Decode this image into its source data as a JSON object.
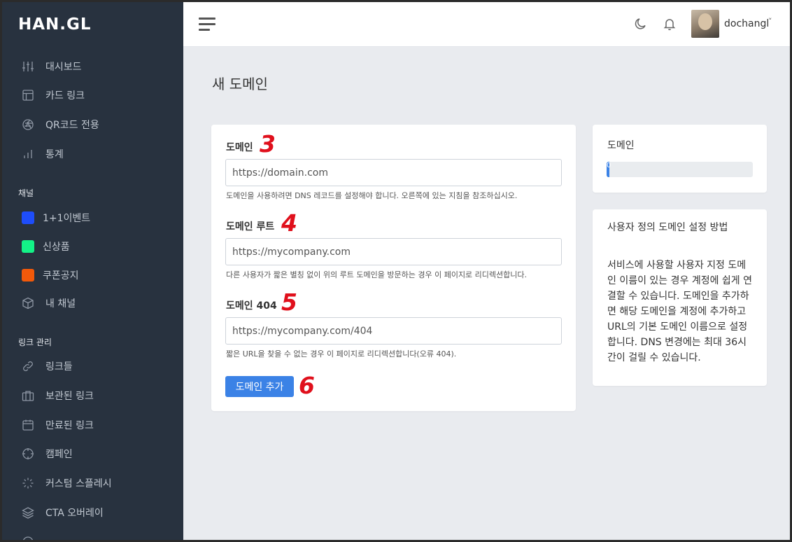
{
  "brand": {
    "logo": "HAN.GL"
  },
  "sidebar": {
    "main_items": [
      {
        "label": "대시보드",
        "icon": "sliders-icon"
      },
      {
        "label": "카드 링크",
        "icon": "layout-icon"
      },
      {
        "label": "QR코드 전용",
        "icon": "aperture-icon"
      },
      {
        "label": "통계",
        "icon": "bar-chart-icon"
      }
    ],
    "channels_title": "채널",
    "channels": [
      {
        "label": "1+1이벤트",
        "color": "#1e4dfa"
      },
      {
        "label": "신상품",
        "color": "#13f287"
      },
      {
        "label": "쿠폰공지",
        "color": "#f2590a"
      },
      {
        "label": "내 채널",
        "icon": "box-icon"
      }
    ],
    "links_title": "링크 관리",
    "link_items": [
      {
        "label": "링크들",
        "icon": "link-icon"
      },
      {
        "label": "보관된 링크",
        "icon": "briefcase-icon"
      },
      {
        "label": "만료된 링크",
        "icon": "calendar-icon"
      },
      {
        "label": "캠페인",
        "icon": "crosshair-icon"
      },
      {
        "label": "커스텀 스플레시",
        "icon": "loader-icon"
      },
      {
        "label": "CTA 오버레이",
        "icon": "layers-icon"
      }
    ]
  },
  "header": {
    "username": "dochangl",
    "caret": "˅"
  },
  "page": {
    "title": "새 도메인"
  },
  "form": {
    "domain": {
      "label": "도메인",
      "marker": "3",
      "placeholder": "https://domain.com",
      "help": "도메인을 사용하려면 DNS 레코드를 설정해야 합니다. 오른쪽에 있는 지침을 참조하십시오."
    },
    "root": {
      "label": "도메인 루트",
      "marker": "4",
      "placeholder": "https://mycompany.com",
      "help": "다른 사용자가 짧은 별칭 없이 위의 루트 도메인을 방문하는 경우 이 페이지로 리디렉션합니다."
    },
    "notfound": {
      "label": "도메인 404",
      "marker": "5",
      "placeholder": "https://mycompany.com/404",
      "help": "짧은 URL을 찾을 수 없는 경우 이 페이지로 리디렉션합니다(오류 404)."
    },
    "submit": {
      "label": "도메인 추가",
      "marker": "6"
    }
  },
  "domain_card": {
    "title": "도메인",
    "progress_text": "0",
    "progress_percent": 2
  },
  "guide_card": {
    "title": "사용자 정의 도메인 설정 방법",
    "body": "서비스에 사용할 사용자 지정 도메인 이름이 있는 경우 계정에 쉽게 연결할 수 있습니다. 도메인을 추가하면 해당 도메인을 계정에 추가하고 URL의 기본 도메인 이름으로 설정합니다. DNS 변경에는 최대 36시간이 걸릴 수 있습니다."
  }
}
